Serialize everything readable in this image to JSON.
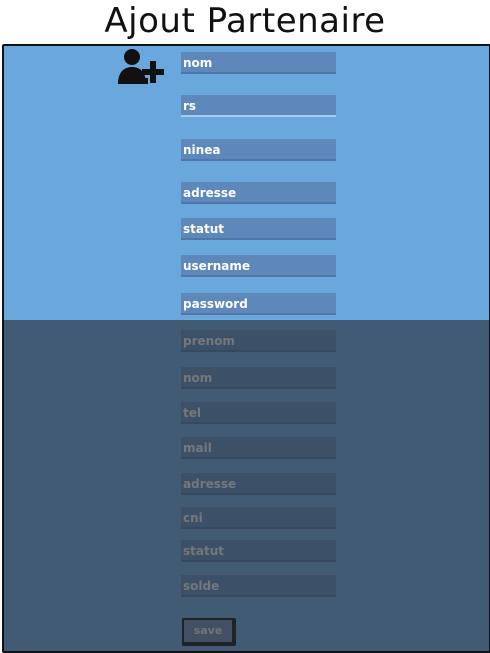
{
  "title": "Ajout Partenaire",
  "icons": {
    "add_user": "add-user-icon"
  },
  "partner_fields": {
    "nom": "nom",
    "rs": "rs",
    "ninea": "ninea",
    "adresse": "adresse",
    "statut": "statut",
    "username": "username",
    "password": "password"
  },
  "user_fields": {
    "prenom": "prenom",
    "nom": "nom",
    "tel": "tel",
    "mail": "mail",
    "adresse": "adresse",
    "cni": "cni",
    "statut": "statut",
    "solde": "solde"
  },
  "save_label": "save",
  "colors": {
    "panel_background": "#6aa7dc",
    "field_background": "#5e88ba",
    "overlay": "#3b4d61"
  }
}
